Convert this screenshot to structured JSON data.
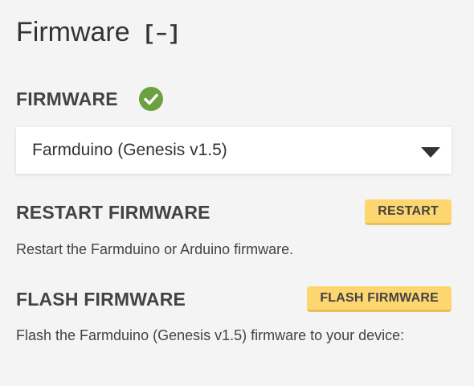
{
  "header": {
    "title": "Firmware",
    "collapse_label": "[–]"
  },
  "firmware": {
    "label": "FIRMWARE",
    "status_icon": "check-circle-icon",
    "status_color": "#6ca142",
    "selected": "Farmduino (Genesis v1.5)"
  },
  "restart": {
    "title": "RESTART FIRMWARE",
    "button_label": "RESTART",
    "description": "Restart the Farmduino or Arduino firmware."
  },
  "flash": {
    "title": "FLASH FIRMWARE",
    "button_label": "FLASH FIRMWARE",
    "description": "Flash the Farmduino (Genesis v1.5) firmware to your device:"
  },
  "colors": {
    "button_bg": "#fdd670",
    "text": "#434343",
    "background": "#f4f4f4"
  }
}
